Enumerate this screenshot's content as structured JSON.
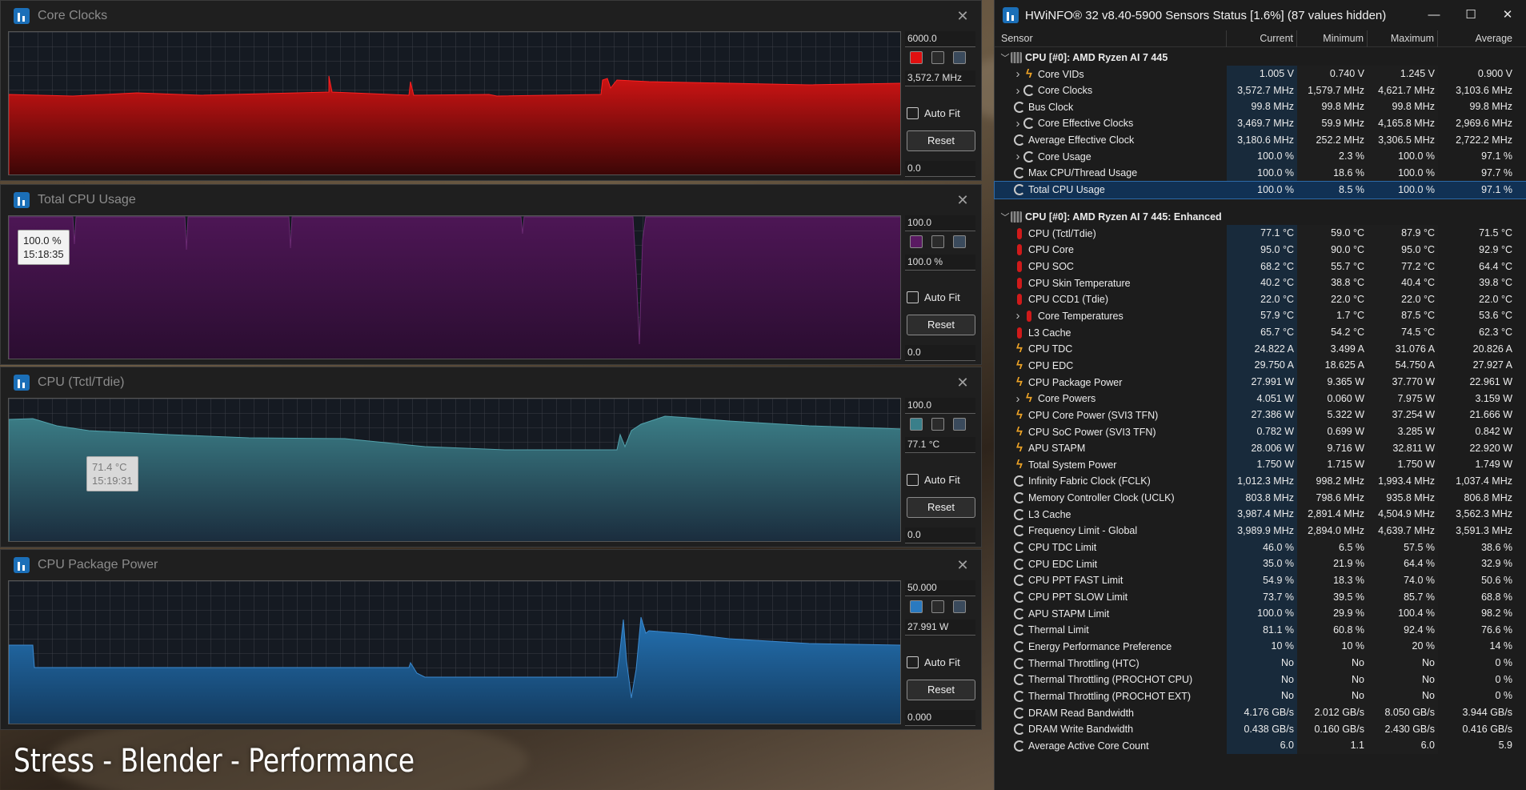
{
  "colors": {
    "clocks": "#c40f10",
    "usage": "#4a1450",
    "temp": "#2f6a73",
    "power": "#1d5d96"
  },
  "graphs": [
    {
      "title": "Core Clocks",
      "max": "6000.0",
      "current": "3,572.7 MHz",
      "min": "0.0",
      "autofit": "Auto Fit",
      "reset": "Reset",
      "tooltip": null
    },
    {
      "title": "Total CPU Usage",
      "max": "100.0",
      "current": "100.0 %",
      "min": "0.0",
      "autofit": "Auto Fit",
      "reset": "Reset",
      "tooltip": {
        "value": "100.0 %",
        "time": "15:18:35"
      }
    },
    {
      "title": "CPU (Tctl/Tdie)",
      "max": "100.0",
      "current": "77.1 °C",
      "min": "0.0",
      "autofit": "Auto Fit",
      "reset": "Reset",
      "tooltip": {
        "value": "71.4 °C",
        "time": "15:19:31"
      }
    },
    {
      "title": "CPU Package Power",
      "max": "50.000",
      "current": "27.991 W",
      "min": "0.000",
      "autofit": "Auto Fit",
      "reset": "Reset",
      "tooltip": null
    }
  ],
  "sensor_window": {
    "title": "HWiNFO® 32 v8.40-5900 Sensors Status [1.6%] (87 values hidden)",
    "columns": [
      "Sensor",
      "Current",
      "Minimum",
      "Maximum",
      "Average"
    ],
    "rows": [
      {
        "type": "group",
        "name": "CPU [#0]: AMD Ryzen AI 7 445"
      },
      {
        "type": "item",
        "expand": true,
        "icon": "bolt",
        "name": "Core VIDs",
        "cur": "1.005 V",
        "min": "0.740 V",
        "max": "1.245 V",
        "avg": "0.900 V"
      },
      {
        "type": "item",
        "expand": true,
        "icon": "clock",
        "name": "Core Clocks",
        "cur": "3,572.7 MHz",
        "min": "1,579.7 MHz",
        "max": "4,621.7 MHz",
        "avg": "3,103.6 MHz"
      },
      {
        "type": "item",
        "icon": "clock",
        "name": "Bus Clock",
        "cur": "99.8 MHz",
        "min": "99.8 MHz",
        "max": "99.8 MHz",
        "avg": "99.8 MHz"
      },
      {
        "type": "item",
        "expand": true,
        "icon": "clock",
        "name": "Core Effective Clocks",
        "cur": "3,469.7 MHz",
        "min": "59.9 MHz",
        "max": "4,165.8 MHz",
        "avg": "2,969.6 MHz"
      },
      {
        "type": "item",
        "icon": "clock",
        "name": "Average Effective Clock",
        "cur": "3,180.6 MHz",
        "min": "252.2 MHz",
        "max": "3,306.5 MHz",
        "avg": "2,722.2 MHz"
      },
      {
        "type": "item",
        "expand": true,
        "icon": "clock",
        "name": "Core Usage",
        "cur": "100.0 %",
        "min": "2.3 %",
        "max": "100.0 %",
        "avg": "97.1 %"
      },
      {
        "type": "item",
        "icon": "clock",
        "name": "Max CPU/Thread Usage",
        "cur": "100.0 %",
        "min": "18.6 %",
        "max": "100.0 %",
        "avg": "97.7 %"
      },
      {
        "type": "item",
        "icon": "clock",
        "name": "Total CPU Usage",
        "cur": "100.0 %",
        "min": "8.5 %",
        "max": "100.0 %",
        "avg": "97.1 %",
        "selected": true
      },
      {
        "type": "spacer"
      },
      {
        "type": "group",
        "name": "CPU [#0]: AMD Ryzen AI 7 445: Enhanced"
      },
      {
        "type": "item",
        "icon": "therm",
        "name": "CPU (Tctl/Tdie)",
        "cur": "77.1 °C",
        "min": "59.0 °C",
        "max": "87.9 °C",
        "avg": "71.5 °C"
      },
      {
        "type": "item",
        "icon": "therm",
        "name": "CPU Core",
        "cur": "95.0 °C",
        "min": "90.0 °C",
        "max": "95.0 °C",
        "avg": "92.9 °C"
      },
      {
        "type": "item",
        "icon": "therm",
        "name": "CPU SOC",
        "cur": "68.2 °C",
        "min": "55.7 °C",
        "max": "77.2 °C",
        "avg": "64.4 °C"
      },
      {
        "type": "item",
        "icon": "therm",
        "name": "CPU Skin Temperature",
        "cur": "40.2 °C",
        "min": "38.8 °C",
        "max": "40.4 °C",
        "avg": "39.8 °C"
      },
      {
        "type": "item",
        "icon": "therm",
        "name": "CPU CCD1 (Tdie)",
        "cur": "22.0 °C",
        "min": "22.0 °C",
        "max": "22.0 °C",
        "avg": "22.0 °C"
      },
      {
        "type": "item",
        "expand": true,
        "icon": "therm",
        "name": "Core Temperatures",
        "cur": "57.9 °C",
        "min": "1.7 °C",
        "max": "87.5 °C",
        "avg": "53.6 °C"
      },
      {
        "type": "item",
        "icon": "therm",
        "name": "L3 Cache",
        "cur": "65.7 °C",
        "min": "54.2 °C",
        "max": "74.5 °C",
        "avg": "62.3 °C"
      },
      {
        "type": "item",
        "icon": "bolt",
        "name": "CPU TDC",
        "cur": "24.822 A",
        "min": "3.499 A",
        "max": "31.076 A",
        "avg": "20.826 A"
      },
      {
        "type": "item",
        "icon": "bolt",
        "name": "CPU EDC",
        "cur": "29.750 A",
        "min": "18.625 A",
        "max": "54.750 A",
        "avg": "27.927 A"
      },
      {
        "type": "item",
        "icon": "bolt",
        "name": "CPU Package Power",
        "cur": "27.991 W",
        "min": "9.365 W",
        "max": "37.770 W",
        "avg": "22.961 W"
      },
      {
        "type": "item",
        "expand": true,
        "icon": "bolt",
        "name": "Core Powers",
        "cur": "4.051 W",
        "min": "0.060 W",
        "max": "7.975 W",
        "avg": "3.159 W"
      },
      {
        "type": "item",
        "icon": "bolt",
        "name": "CPU Core Power (SVI3 TFN)",
        "cur": "27.386 W",
        "min": "5.322 W",
        "max": "37.254 W",
        "avg": "21.666 W"
      },
      {
        "type": "item",
        "icon": "bolt",
        "name": "CPU SoC Power (SVI3 TFN)",
        "cur": "0.782 W",
        "min": "0.699 W",
        "max": "3.285 W",
        "avg": "0.842 W"
      },
      {
        "type": "item",
        "icon": "bolt",
        "name": "APU STAPM",
        "cur": "28.006 W",
        "min": "9.716 W",
        "max": "32.811 W",
        "avg": "22.920 W"
      },
      {
        "type": "item",
        "icon": "bolt",
        "name": "Total System Power",
        "cur": "1.750 W",
        "min": "1.715 W",
        "max": "1.750 W",
        "avg": "1.749 W"
      },
      {
        "type": "item",
        "icon": "clock",
        "name": "Infinity Fabric Clock (FCLK)",
        "cur": "1,012.3 MHz",
        "min": "998.2 MHz",
        "max": "1,993.4 MHz",
        "avg": "1,037.4 MHz"
      },
      {
        "type": "item",
        "icon": "clock",
        "name": "Memory Controller Clock (UCLK)",
        "cur": "803.8 MHz",
        "min": "798.6 MHz",
        "max": "935.8 MHz",
        "avg": "806.8 MHz"
      },
      {
        "type": "item",
        "icon": "clock",
        "name": "L3 Cache",
        "cur": "3,987.4 MHz",
        "min": "2,891.4 MHz",
        "max": "4,504.9 MHz",
        "avg": "3,562.3 MHz"
      },
      {
        "type": "item",
        "icon": "clock",
        "name": "Frequency Limit - Global",
        "cur": "3,989.9 MHz",
        "min": "2,894.0 MHz",
        "max": "4,639.7 MHz",
        "avg": "3,591.3 MHz"
      },
      {
        "type": "item",
        "icon": "clock",
        "name": "CPU TDC Limit",
        "cur": "46.0 %",
        "min": "6.5 %",
        "max": "57.5 %",
        "avg": "38.6 %"
      },
      {
        "type": "item",
        "icon": "clock",
        "name": "CPU EDC Limit",
        "cur": "35.0 %",
        "min": "21.9 %",
        "max": "64.4 %",
        "avg": "32.9 %"
      },
      {
        "type": "item",
        "icon": "clock",
        "name": "CPU PPT FAST Limit",
        "cur": "54.9 %",
        "min": "18.3 %",
        "max": "74.0 %",
        "avg": "50.6 %"
      },
      {
        "type": "item",
        "icon": "clock",
        "name": "CPU PPT SLOW Limit",
        "cur": "73.7 %",
        "min": "39.5 %",
        "max": "85.7 %",
        "avg": "68.8 %"
      },
      {
        "type": "item",
        "icon": "clock",
        "name": "APU STAPM Limit",
        "cur": "100.0 %",
        "min": "29.9 %",
        "max": "100.4 %",
        "avg": "98.2 %"
      },
      {
        "type": "item",
        "icon": "clock",
        "name": "Thermal Limit",
        "cur": "81.1 %",
        "min": "60.8 %",
        "max": "92.4 %",
        "avg": "76.6 %"
      },
      {
        "type": "item",
        "icon": "clock",
        "name": "Energy Performance Preference",
        "cur": "10 %",
        "min": "10 %",
        "max": "20 %",
        "avg": "14 %"
      },
      {
        "type": "item",
        "icon": "clock",
        "name": "Thermal Throttling (HTC)",
        "cur": "No",
        "min": "No",
        "max": "No",
        "avg": "0 %"
      },
      {
        "type": "item",
        "icon": "clock",
        "name": "Thermal Throttling (PROCHOT CPU)",
        "cur": "No",
        "min": "No",
        "max": "No",
        "avg": "0 %"
      },
      {
        "type": "item",
        "icon": "clock",
        "name": "Thermal Throttling (PROCHOT EXT)",
        "cur": "No",
        "min": "No",
        "max": "No",
        "avg": "0 %"
      },
      {
        "type": "item",
        "icon": "clock",
        "name": "DRAM Read Bandwidth",
        "cur": "4.176 GB/s",
        "min": "2.012 GB/s",
        "max": "8.050 GB/s",
        "avg": "3.944 GB/s"
      },
      {
        "type": "item",
        "icon": "clock",
        "name": "DRAM Write Bandwidth",
        "cur": "0.438 GB/s",
        "min": "0.160 GB/s",
        "max": "2.430 GB/s",
        "avg": "0.416 GB/s"
      },
      {
        "type": "item",
        "icon": "clock",
        "name": "Average Active Core Count",
        "cur": "6.0",
        "min": "1.1",
        "max": "6.0",
        "avg": "5.9"
      }
    ]
  },
  "caption": "Stress - Blender - Performance"
}
